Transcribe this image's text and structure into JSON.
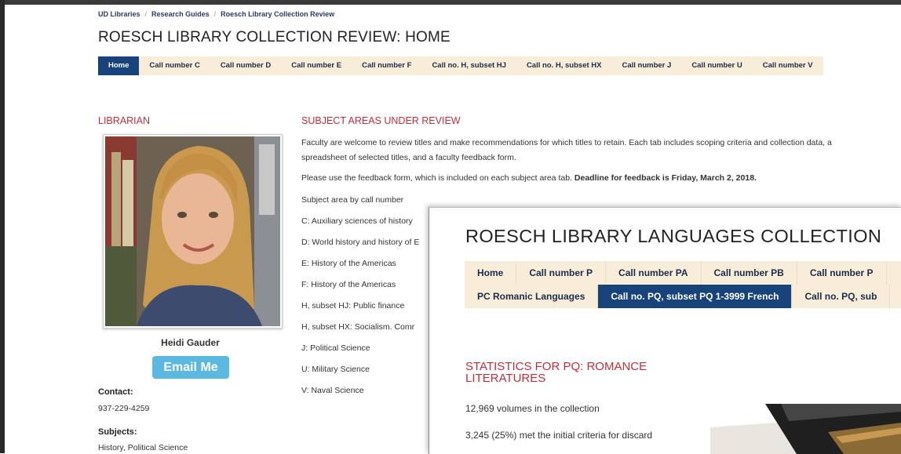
{
  "breadcrumb": [
    "UD Libraries",
    "Research Guides",
    "Roesch Library Collection Review"
  ],
  "page_title": "ROESCH LIBRARY COLLECTION REVIEW: HOME",
  "tabs": [
    {
      "label": "Home",
      "active": true
    },
    {
      "label": "Call number C"
    },
    {
      "label": "Call number D"
    },
    {
      "label": "Call number E"
    },
    {
      "label": "Call number F"
    },
    {
      "label": "Call no. H, subset HJ"
    },
    {
      "label": "Call no. H, subset HX"
    },
    {
      "label": "Call number J"
    },
    {
      "label": "Call number U"
    },
    {
      "label": "Call number V"
    }
  ],
  "librarian": {
    "heading": "LIBRARIAN",
    "name": "Heidi Gauder",
    "email_button": "Email Me",
    "contact_label": "Contact:",
    "contact_value": "937-229-4259",
    "subjects_label": "Subjects:",
    "subjects_value": "History, Political Science"
  },
  "subject_areas": {
    "heading": "SUBJECT AREAS UNDER REVIEW",
    "intro_line1": "Faculty are welcome to review titles and make recommendations for which titles to retain.  Each tab includes scoping criteria and collection data, a",
    "intro_line2": "spreadsheet of selected titles, and a faculty feedback form.",
    "feedback_text": "Please use the feedback form, which is included on each subject area tab.",
    "deadline_text": "Deadline for feedback is Friday, March 2, 2018.",
    "list_label": "Subject area by call number",
    "items": [
      "C:  Auxiliary sciences of history",
      "D:  World history and history of E",
      "E:  History of the Americas",
      "F:  History of the Americas",
      "H, subset HJ:  Public finance",
      "H, subset HX:  Socialism.  Comr",
      "J: Political Science",
      "U:  Military Science",
      "V:  Naval Science"
    ]
  },
  "overlay": {
    "title": "ROESCH LIBRARY LANGUAGES COLLECTION",
    "tabs_row1": [
      "Home",
      "Call number P",
      "Call number PA",
      "Call number PB",
      "Call number P"
    ],
    "tabs_row2": [
      {
        "label": "PC Romanic Languages"
      },
      {
        "label": "Call no. PQ, subset PQ 1-3999 French",
        "active": true
      },
      {
        "label": "Call no. PQ, sub"
      }
    ],
    "stats_heading_line1": "STATISTICS FOR PQ: ROMANCE",
    "stats_heading_line2": "LITERATURES",
    "stat1": "12,969 volumes in the collection",
    "stat2": "3,245 (25%) met the initial criteria for discard"
  },
  "colors": {
    "accent_red": "#c62d3a",
    "tab_bg": "#f8edd8",
    "tab_active": "#17427a",
    "email_button": "#5bb8e0"
  }
}
